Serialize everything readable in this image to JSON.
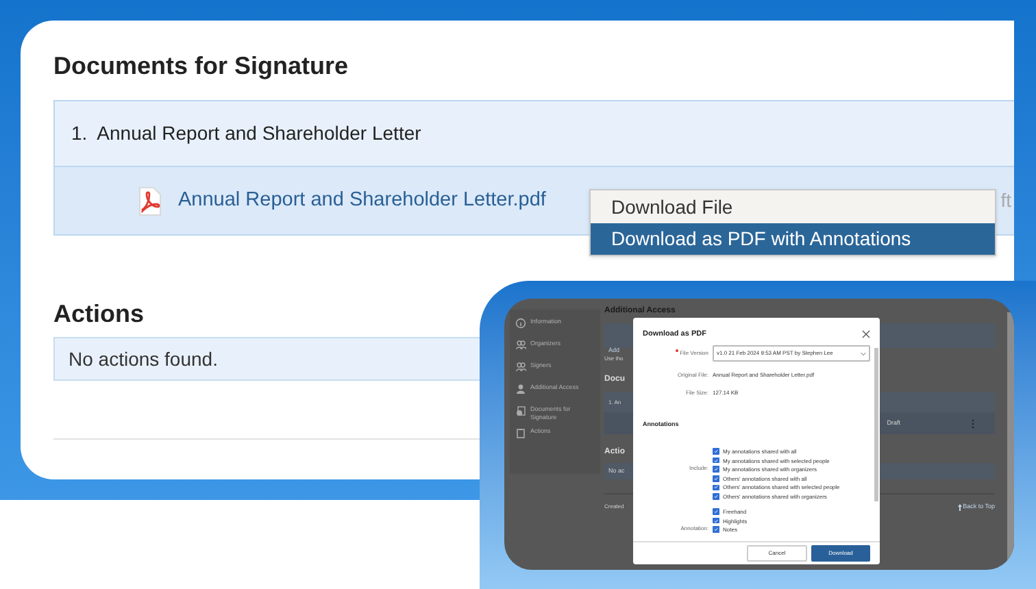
{
  "main": {
    "heading": "Documents for Signature",
    "documents": [
      {
        "number": "1.",
        "title": "Annual Report and Shareholder Letter",
        "file": "Annual Report and Shareholder Letter.pdf",
        "status": "ft"
      }
    ],
    "menu": [
      {
        "label": "Download File",
        "selected": false
      },
      {
        "label": "Download as PDF with Annotations",
        "selected": true
      }
    ],
    "actions_heading": "Actions",
    "actions_empty": "No actions found."
  },
  "inset": {
    "sidebar": [
      {
        "label": "Information"
      },
      {
        "label": "Organizers"
      },
      {
        "label": "Signers"
      },
      {
        "label": "Additional Access"
      },
      {
        "label": "Documents for Signature"
      },
      {
        "label": "Actions"
      }
    ],
    "background": {
      "heading": "Additional Access",
      "add": "Add",
      "use": "Use tho",
      "docs_heading": "Docu",
      "row": "1. An",
      "status": "Draft",
      "actions_heading": "Actio",
      "actions_empty": "No ac",
      "created": "Created",
      "back_to_top": "Back to Top"
    },
    "dialog": {
      "title": "Download as PDF",
      "file_version": {
        "label": "File Version",
        "required": true,
        "value": "v1.0 21 Feb 2024 9:53 AM PST by Stephen Lee"
      },
      "original_file": {
        "label": "Original File:",
        "value": "Annual Report and Shareholder Letter.pdf"
      },
      "file_size": {
        "label": "File Size:",
        "value": "127.14 KB"
      },
      "annotations_heading": "Annotations",
      "include": {
        "label": "Include:",
        "options": [
          {
            "label": "My annotations shared with all",
            "checked": true
          },
          {
            "label": "My annotations shared with selected people",
            "checked": true
          },
          {
            "label": "My annotations shared with organizers",
            "checked": true
          },
          {
            "label": "Others' annotations shared with all",
            "checked": true
          },
          {
            "label": "Others' annotations shared with selected people",
            "checked": true
          },
          {
            "label": "Others' annotations shared with organizers",
            "checked": true
          }
        ]
      },
      "annotation": {
        "label": "Annotation:",
        "options": [
          {
            "label": "Freehand",
            "checked": true
          },
          {
            "label": "Highlights",
            "checked": true
          },
          {
            "label": "Notes",
            "checked": true
          }
        ]
      },
      "buttons": {
        "cancel": "Cancel",
        "download": "Download"
      }
    }
  }
}
